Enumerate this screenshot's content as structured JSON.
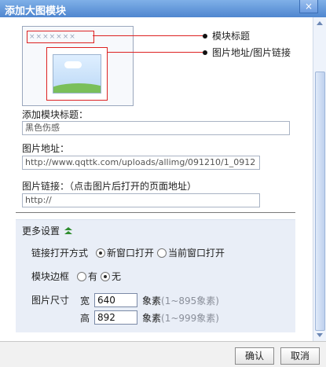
{
  "dialog": {
    "title": "添加大图模块",
    "close_glyph": "×"
  },
  "preview": {
    "title_placeholder": "×××××××",
    "callout_title": "模块标题",
    "callout_image": "图片地址/图片链接"
  },
  "form": {
    "module_title_label": "添加模块标题：",
    "module_title_value": "黑色伤感",
    "image_url_label": "图片地址：",
    "image_url_value": "http://www.qqttk.com/uploads/allimg/091210/1_0912",
    "image_link_label": "图片链接：（点击图片后打开的页面地址）",
    "image_link_value": "http://"
  },
  "more_settings": {
    "header": "更多设置",
    "link_open_label": "链接打开方式",
    "link_open_options": [
      "新窗口打开",
      "当前窗口打开"
    ],
    "link_open_selected": "新窗口打开",
    "border_label": "模块边框",
    "border_options": [
      "有",
      "无"
    ],
    "border_selected": "无",
    "image_size_label": "图片尺寸",
    "width_label": "宽",
    "width_value": "640",
    "width_hint_unit": "象素",
    "width_hint_range": "(1~895象素)",
    "height_label": "高",
    "height_value": "892",
    "height_hint_unit": "象素",
    "height_hint_range": "(1~999象素)"
  },
  "footer": {
    "confirm": "确认",
    "cancel": "取消"
  },
  "colors": {
    "callout_red": "#dd2222",
    "title_bar": "#4f86cf",
    "settings_bg": "#e9eef7",
    "chevron_green": "#2f8d2f"
  }
}
